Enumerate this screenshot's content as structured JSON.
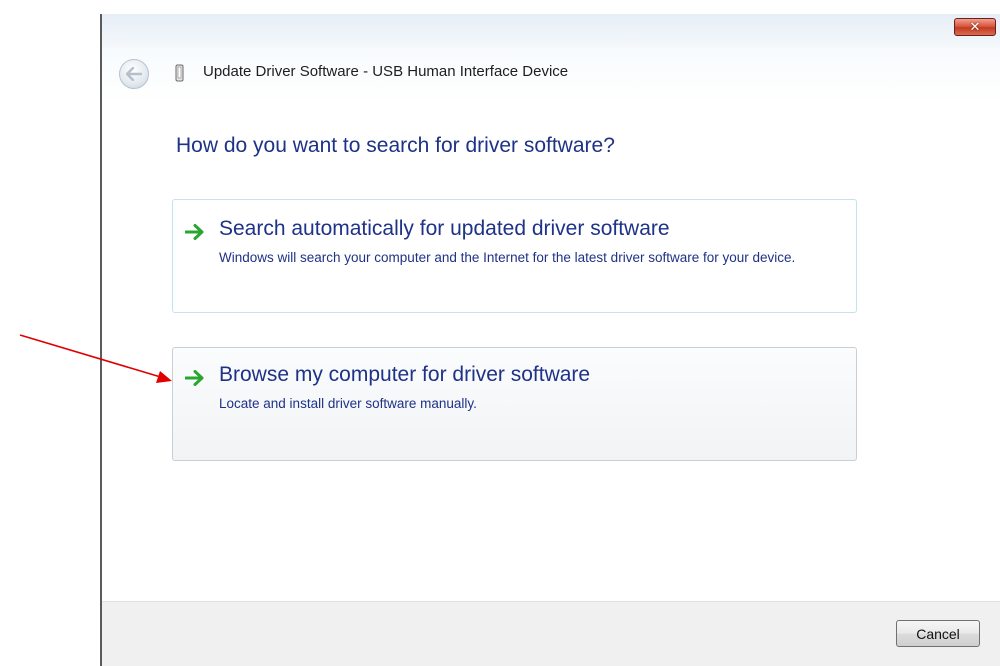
{
  "window": {
    "title": "Update Driver Software - USB Human Interface Device",
    "close_glyph": "✕"
  },
  "main_instruction": "How do you want to search for driver software?",
  "options": [
    {
      "title": "Search automatically for updated driver software",
      "description": "Windows will search your computer and the Internet for the latest driver software for your device.",
      "icon": "green-arrow-icon"
    },
    {
      "title": "Browse my computer for driver software",
      "description": "Locate and install driver software manually.",
      "icon": "green-arrow-icon"
    }
  ],
  "footer": {
    "cancel_label": "Cancel"
  },
  "colors": {
    "link_text": "#1e3287",
    "arrow_green": "#2aa52f",
    "annotation_red": "#e00000",
    "close_red": "#c23a22"
  },
  "icons": {
    "back": "back-arrow-icon",
    "device": "usb-device-icon",
    "close": "close-icon",
    "annotation": "red-pointer-arrow"
  }
}
